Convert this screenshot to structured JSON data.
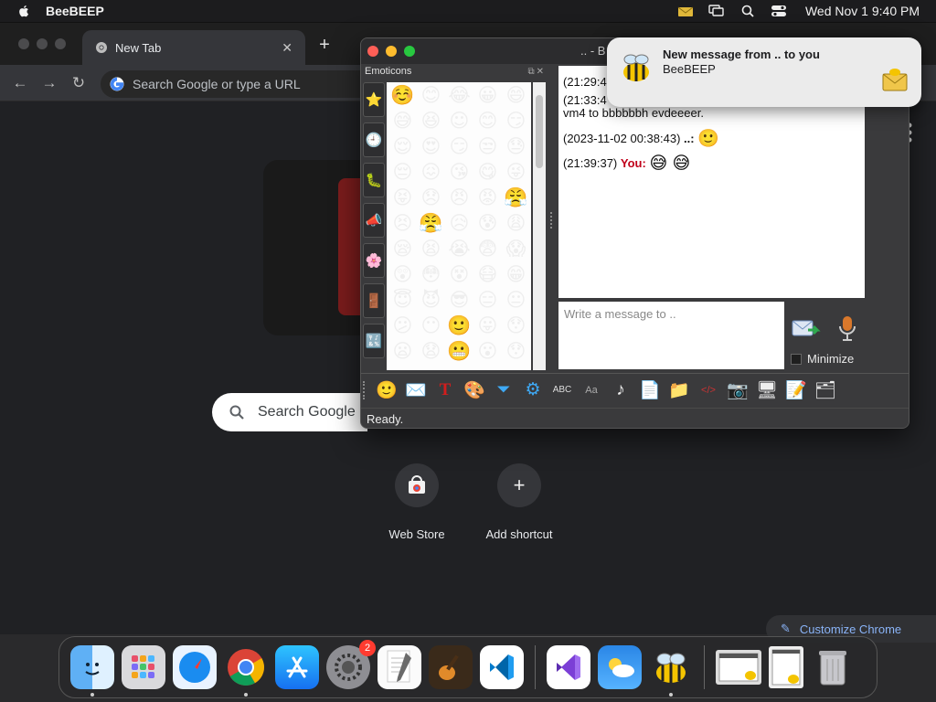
{
  "menubar": {
    "app_name": "BeeBEEP",
    "clock": "Wed Nov 1  9:40 PM"
  },
  "chrome": {
    "tab_label": "New Tab",
    "omnibox_placeholder": "Search Google or type a URL",
    "search_box_text": "Search Google",
    "shortcuts": [
      {
        "label": "Web Store",
        "icon": "web-store-icon"
      },
      {
        "label": "Add shortcut",
        "icon": "plus-icon"
      }
    ],
    "customize_label": "Customize Chrome"
  },
  "beebeep": {
    "window_title": ".. - B",
    "emoticons_header": "Emoticons",
    "emoticons": [
      "☺️",
      "😊",
      "😂",
      "😀",
      "😄",
      "😅",
      "😆",
      "☺",
      "😊",
      "😏",
      "😌",
      "😍",
      "😏",
      "😒",
      "😓",
      "😔",
      "😖",
      "😘",
      "😋",
      "😜",
      "😝",
      "😞",
      "😠",
      "😡",
      "😤",
      "😣",
      "😤",
      "😥",
      "😰",
      "😩",
      "😪",
      "😫",
      "😭",
      "😨",
      "😱",
      "😲",
      "😳",
      "😵",
      "😷",
      "😁",
      "😇",
      "😈",
      "😎",
      "😑",
      "😐",
      "😕",
      "😶",
      "🙂",
      "😛",
      "😯",
      "😦",
      "😧",
      "😬",
      "😮",
      "😯"
    ],
    "chat": [
      {
        "time": "(21:29:4",
        "text": ""
      },
      {
        "time": "(21:33:4",
        "text": ""
      },
      {
        "time": "",
        "text": "vm4 to bbbbbbh evdeeeer."
      },
      {
        "time": "(2023-11-02 00:38:43)",
        "sender": "..:",
        "emoji": "🙂"
      },
      {
        "time": "(21:39:37)",
        "sender": "You:",
        "emoji": "😅 😅"
      }
    ],
    "message_placeholder": "Write a message to ..",
    "minimize_label": "Minimize",
    "status": "Ready."
  },
  "notification": {
    "title": "New message from .. to you",
    "body": "BeeBEEP"
  },
  "dock": {
    "apps": [
      "finder-icon",
      "launchpad-icon",
      "safari-icon",
      "chrome-icon",
      "app-store-icon",
      "system-settings-icon",
      "textedit-icon",
      "garageband-icon",
      "vscode-icon",
      "visual-studio-icon",
      "weather-icon",
      "beebeep-icon",
      "screenshot1-icon",
      "screenshot2-icon",
      "trash-icon"
    ],
    "settings_badge": "2"
  }
}
